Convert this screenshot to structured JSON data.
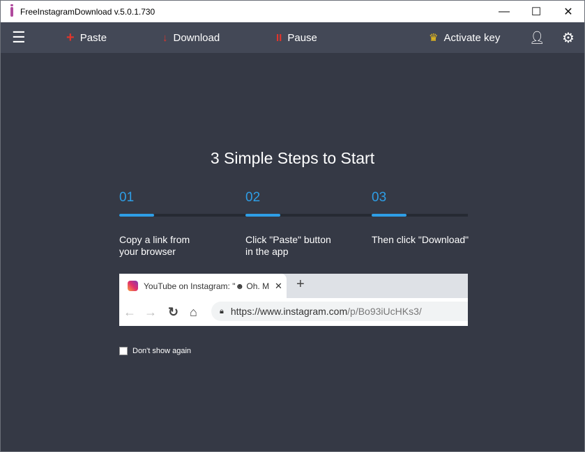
{
  "window": {
    "title": "FreeInstagramDownload  v.5.0.1.730",
    "minimize": "—",
    "maximize": "☐",
    "close": "✕"
  },
  "toolbar": {
    "paste": "Paste",
    "download": "Download",
    "pause": "Pause",
    "activate": "Activate key"
  },
  "main": {
    "heading": "3 Simple Steps to Start",
    "steps": [
      {
        "num": "01",
        "l1": "Copy a link from",
        "l2": "your browser"
      },
      {
        "num": "02",
        "l1": "Click \"Paste\" button",
        "l2": "in the app"
      },
      {
        "num": "03",
        "l1": "Then click \"Download\"",
        "l2": ""
      }
    ],
    "browser": {
      "tab_title": "YouTube on Instagram: \"☻ Oh. M",
      "url_host": "https://www.instagram.com",
      "url_path": "/p/Bo93iUcHKs3/"
    },
    "dont_show": "Don't show again"
  }
}
